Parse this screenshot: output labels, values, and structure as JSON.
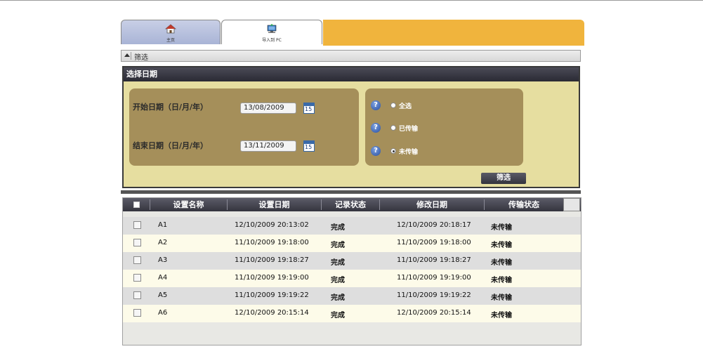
{
  "tabs": [
    {
      "label": "主页",
      "icon": "home-icon"
    },
    {
      "label": "导入到 PC",
      "icon": "import-pc-icon"
    }
  ],
  "filter_bar": {
    "label": "筛选"
  },
  "date_panel": {
    "title": "选择日期",
    "start_label": "开始日期（日/月/年）",
    "start_value": "13/08/2009",
    "end_label": "结束日期（日/月/年）",
    "end_value": "13/11/2009",
    "calendar_icon_text": "15",
    "radios": [
      {
        "label": "全选",
        "selected": false
      },
      {
        "label": "已传输",
        "selected": false
      },
      {
        "label": "未传输",
        "selected": true
      }
    ],
    "filter_button": "筛选"
  },
  "table": {
    "columns": [
      "设置名称",
      "设置日期",
      "记录状态",
      "修改日期",
      "传输状态"
    ],
    "rows": [
      {
        "name": "A1",
        "set_date": "12/10/2009 20:13:02",
        "record_status": "完成",
        "modified": "12/10/2009 20:18:17",
        "transfer": "未传输"
      },
      {
        "name": "A2",
        "set_date": "11/10/2009 19:18:00",
        "record_status": "完成",
        "modified": "11/10/2009 19:18:00",
        "transfer": "未传输"
      },
      {
        "name": "A3",
        "set_date": "11/10/2009 19:18:27",
        "record_status": "完成",
        "modified": "11/10/2009 19:18:27",
        "transfer": "未传输"
      },
      {
        "name": "A4",
        "set_date": "11/10/2009 19:19:00",
        "record_status": "完成",
        "modified": "11/10/2009 19:19:00",
        "transfer": "未传输"
      },
      {
        "name": "A5",
        "set_date": "11/10/2009 19:19:22",
        "record_status": "完成",
        "modified": "11/10/2009 19:19:22",
        "transfer": "未传输"
      },
      {
        "name": "A6",
        "set_date": "12/10/2009 20:15:14",
        "record_status": "完成",
        "modified": "12/10/2009 20:15:14",
        "transfer": "未传输"
      }
    ]
  },
  "colors": {
    "accent_orange": "#f0b43d",
    "panel_beige": "#e6dea0",
    "box_brown": "#a58f5a",
    "header_dark": "#34343e"
  }
}
